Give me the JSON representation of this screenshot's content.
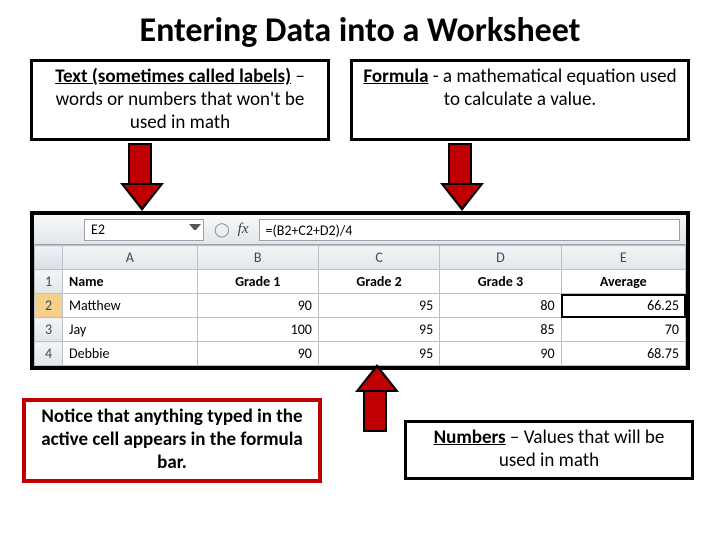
{
  "title": "Entering Data into a Worksheet",
  "callouts": {
    "text_label_bold": "Text (sometimes called labels)",
    "text_label_rest": " – words or numbers that won't be used in math",
    "formula_bold": "Formula",
    "formula_rest": " - a mathematical equation used to calculate a value.",
    "notice": "Notice that anything typed in the active cell appears in the formula bar.",
    "numbers_bold": "Numbers",
    "numbers_rest": " – Values that will be used in math"
  },
  "excel": {
    "namebox": "E2",
    "fx_label": "fx",
    "formula": "=(B2+C2+D2)/4",
    "columns": [
      "A",
      "B",
      "C",
      "D",
      "E"
    ],
    "row_numbers": [
      "1",
      "2",
      "3",
      "4"
    ],
    "headers": [
      "Name",
      "Grade 1",
      "Grade 2",
      "Grade 3",
      "Average"
    ],
    "rows": [
      {
        "name": "Matthew",
        "g1": "90",
        "g2": "95",
        "g3": "80",
        "avg": "66.25"
      },
      {
        "name": "Jay",
        "g1": "100",
        "g2": "95",
        "g3": "85",
        "avg": "70"
      },
      {
        "name": "Debbie",
        "g1": "90",
        "g2": "95",
        "g3": "90",
        "avg": "68.75"
      }
    ]
  }
}
